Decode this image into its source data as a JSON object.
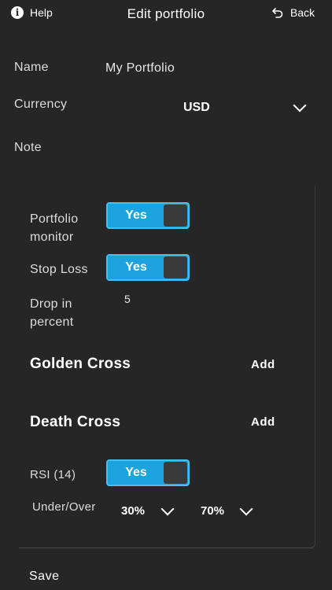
{
  "header": {
    "help_label": "Help",
    "title": "Edit portfolio",
    "back_label": "Back",
    "help_icon": "info-icon",
    "back_icon": "undo-arrow-icon"
  },
  "form": {
    "name_label": "Name",
    "name_value": "My Portfolio",
    "currency_label": "Currency",
    "currency_value": "USD",
    "note_label": "Note"
  },
  "settings": {
    "portfolio_monitor": {
      "label_line1": "Portfolio",
      "label_line2": "monitor",
      "toggle": "Yes"
    },
    "stop_loss": {
      "label": "Stop Loss",
      "toggle": "Yes"
    },
    "drop": {
      "label_line1": "Drop in",
      "label_line2": "percent",
      "value": "5"
    },
    "golden_cross": {
      "title": "Golden Cross",
      "action": "Add"
    },
    "death_cross": {
      "title": "Death Cross",
      "action": "Add"
    },
    "rsi": {
      "label": "RSI (14)",
      "toggle": "Yes"
    },
    "under_over": {
      "label": "Under/Over",
      "under_value": "30%",
      "over_value": "70%"
    }
  },
  "footer": {
    "save_label": "Save"
  },
  "colors": {
    "background": "#262626",
    "toggle_on": "#1aa3dc",
    "text": "#ffffff"
  }
}
